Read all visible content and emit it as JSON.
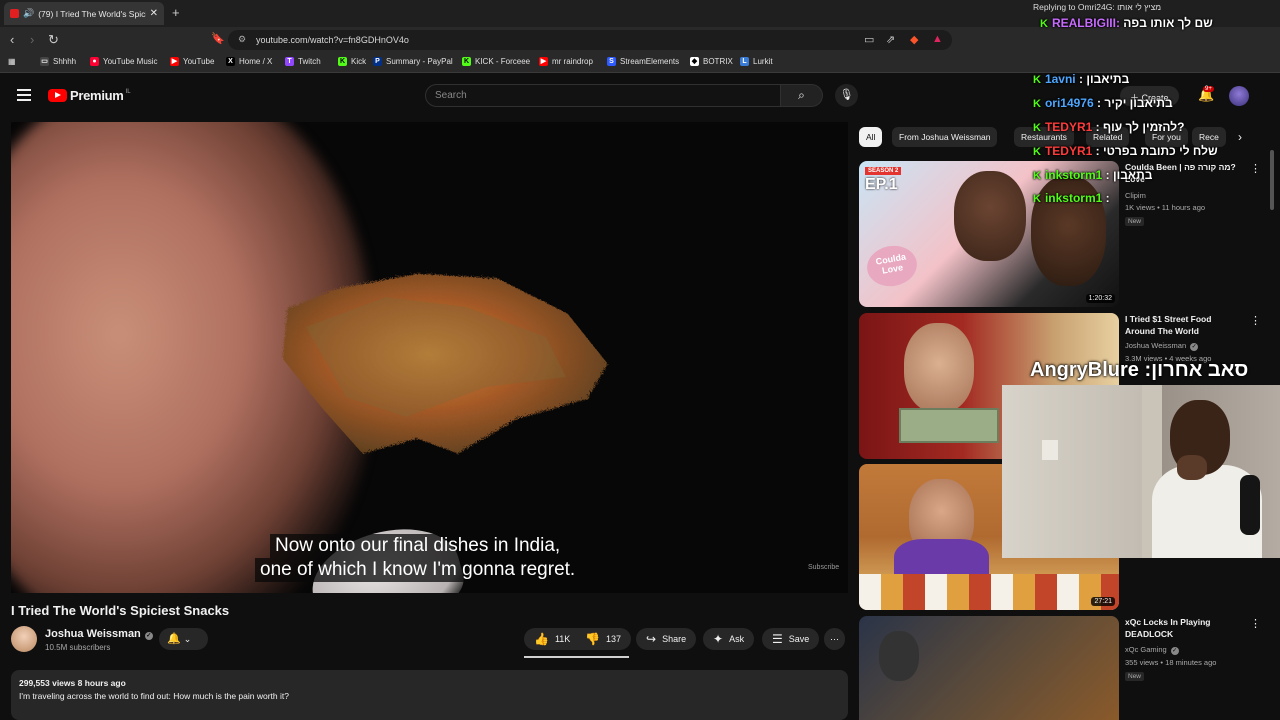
{
  "browser": {
    "tab_title": "(79) I Tried The World's Spicie",
    "url": "youtube.com/watch?v=fn8GDHnOV4o",
    "bookmarks": [
      {
        "label": "Shhhh",
        "color": "#444444",
        "glyph": "▭"
      },
      {
        "label": "YouTube Music",
        "color": "#ff0033",
        "glyph": "●"
      },
      {
        "label": "YouTube",
        "color": "#ff0000",
        "glyph": "▶"
      },
      {
        "label": "Home / X",
        "color": "#000000",
        "glyph": "X"
      },
      {
        "label": "Twitch",
        "color": "#9146ff",
        "glyph": "T"
      },
      {
        "label": "Kick",
        "color": "#53fc18",
        "glyph": "K"
      },
      {
        "label": "Summary - PayPal",
        "color": "#003087",
        "glyph": "P"
      },
      {
        "label": "KICK - Forceee",
        "color": "#53fc18",
        "glyph": "K"
      },
      {
        "label": "mr raindrop",
        "color": "#ff0000",
        "glyph": "▶"
      },
      {
        "label": "StreamElements",
        "color": "#2d5bff",
        "glyph": "S"
      },
      {
        "label": "BOTRIX",
        "color": "#ffffff",
        "glyph": "◆"
      },
      {
        "label": "Lurkit",
        "color": "#3a7bd5",
        "glyph": "L"
      }
    ]
  },
  "youtube": {
    "logo": "Premium",
    "logo_cc": "IL",
    "search_placeholder": "Search",
    "create_label": "Create",
    "notif_count": "9+"
  },
  "video": {
    "subtitle_line1": "Now onto our final dishes in India,",
    "subtitle_line2": "one of which I know I'm gonna regret.",
    "watermark": "Subscribe",
    "title": "I Tried The World's Spiciest Snacks",
    "channel": "Joshua Weissman",
    "subscribers": "10.5M subscribers",
    "likes": "11K",
    "dislikes": "137",
    "share": "Share",
    "ask": "Ask",
    "save": "Save",
    "views_time": "299,553 views  8 hours ago",
    "description": "I'm traveling across the world to find out: How much is the pain worth it?"
  },
  "chips": [
    "All",
    "From Joshua Weissman",
    "Restaurants",
    "Related",
    "For you",
    "Rece"
  ],
  "recommended": [
    {
      "title": "Coulda Been | מה קורה פה? Love",
      "channel": "Clipim",
      "meta": "1K views • 11 hours ago",
      "badge": "New",
      "duration": "1:20:32"
    },
    {
      "title": "I Tried $1 Street Food Around The World",
      "channel": "Joshua Weissman",
      "meta": "3.3M views • 4 weeks ago",
      "badge": "",
      "duration": ""
    },
    {
      "title": "",
      "channel": "",
      "meta": "",
      "badge": "",
      "duration": "27:21"
    },
    {
      "title": "xQc Locks In Playing DEADLOCK",
      "channel": "xQc Gaming",
      "meta": "355 views • 18 minutes ago",
      "badge": "New",
      "duration": ""
    }
  ],
  "chat": {
    "reply_line": "Replying to Omri24G: מציץ לי אותו",
    "messages": [
      {
        "user": "REALBIGIII:",
        "text": "שם לך אותו בפה",
        "color": "#c86bff"
      },
      {
        "user": "1avni",
        "text": ": בתיאבון",
        "color": "#4da6ff"
      },
      {
        "user": "ori14976",
        "text": ": בתיאבון יקיר",
        "color": "#4da6ff"
      },
      {
        "user": "TEDYR1",
        "text": ": להזמין לך עוף?",
        "color": "#ff3b3b"
      },
      {
        "user": "TEDYR1",
        "text": ": שלח לי כתובת בפרטי",
        "color": "#ff3b3b"
      },
      {
        "user": "inkstorm1",
        "text": ": בתאבון",
        "color": "#53fc18"
      },
      {
        "user": "inkstorm1",
        "text": ": ",
        "color": "#53fc18"
      }
    ],
    "alert": "AngryBlure :סאב אחרון"
  }
}
